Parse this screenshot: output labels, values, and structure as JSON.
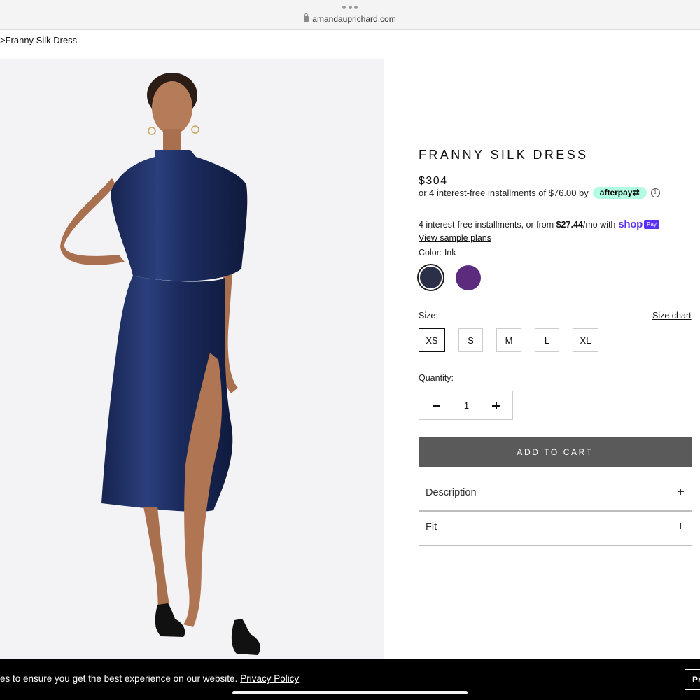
{
  "browser": {
    "url": "amandauprichard.com"
  },
  "breadcrumb": ">Franny Silk Dress",
  "product": {
    "title": "FRANNY SILK DRESS",
    "price": "$304",
    "afterpay_text": "or 4 interest-free installments of $76.00 by",
    "afterpay_badge": "afterpay⇄",
    "info_glyph": "i",
    "shop_pay_text_pre": "4 interest-free installments, or from",
    "shop_pay_amount": "$27.44",
    "shop_pay_text_post": "/mo with",
    "shop_logo": "shop",
    "shop_pay_badge": "Pay",
    "sample_plans": "View sample plans",
    "color_label": "Color: Ink",
    "colors": [
      {
        "name": "Ink",
        "hex": "#2b3048",
        "selected": true
      },
      {
        "name": "Purple",
        "hex": "#5c2b7e",
        "selected": false
      }
    ],
    "size_label": "Size:",
    "size_chart": "Size chart",
    "sizes": [
      "XS",
      "S",
      "M",
      "L",
      "XL"
    ],
    "selected_size": "XS",
    "quantity_label": "Quantity:",
    "quantity": "1",
    "add_to_cart": "ADD TO CART",
    "accordions": [
      "Description",
      "Fit"
    ]
  },
  "cookie": {
    "text": "ies to ensure you get the best experience on our website.",
    "link": "Privacy Policy",
    "button": "Pr"
  },
  "colors": {
    "dress": "#1e2c5a",
    "background": "#f3f3f5",
    "cart_button": "#5a5a5a",
    "afterpay_mint": "#b2fce4",
    "shop_purple": "#5a31f4"
  }
}
